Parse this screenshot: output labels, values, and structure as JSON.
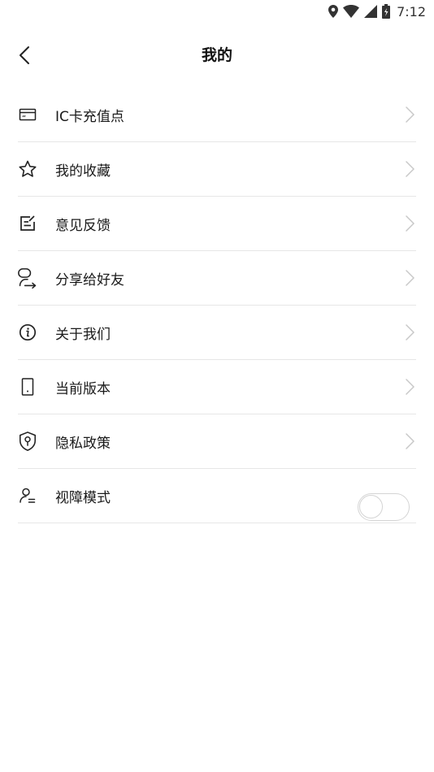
{
  "status_bar": {
    "time": "7:12",
    "icons": [
      "location-icon",
      "wifi-icon",
      "signal-icon",
      "battery-icon"
    ]
  },
  "header": {
    "title": "我的",
    "back_icon": "chevron-left-icon"
  },
  "menu": {
    "items": [
      {
        "label": "IC卡充值点",
        "icon": "card-icon"
      },
      {
        "label": "我的收藏",
        "icon": "star-icon"
      },
      {
        "label": "意见反馈",
        "icon": "feedback-edit-icon"
      },
      {
        "label": "分享给好友",
        "icon": "share-user-icon"
      },
      {
        "label": "关于我们",
        "icon": "info-icon"
      },
      {
        "label": "当前版本",
        "icon": "phone-icon"
      },
      {
        "label": "隐私政策",
        "icon": "shield-lock-icon"
      },
      {
        "label": "视障模式",
        "icon": "accessibility-user-icon",
        "toggle_on": false
      }
    ]
  },
  "colors": {
    "divider": "#e6e6e6",
    "chevron": "#c8c8c8",
    "text": "#1a1a1a",
    "toggle_border": "#d4d4d4"
  }
}
